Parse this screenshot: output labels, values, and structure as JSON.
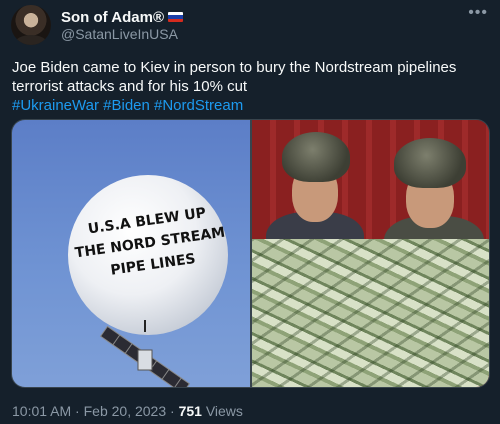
{
  "author": {
    "display_name": "Son of Adam®",
    "handle": "@SatanLiveInUSA"
  },
  "tweet": {
    "text": "Joe Biden came to Kiev in person to bury the Nordstream pipelines terrorist attacks and for his 10% cut",
    "hashtags": "#UkraineWar #Biden #NordStream"
  },
  "media": {
    "balloon_line1": "U.S.A BLEW UP",
    "balloon_line2": "THE NORD STREAM",
    "balloon_line3": "PIPE LINES"
  },
  "meta": {
    "time": "10:01 AM",
    "separator1": " · ",
    "date": "Feb 20, 2023",
    "separator2": " · ",
    "views_count": "751",
    "views_label": " Views"
  },
  "icons": {
    "more": "more-horizontal-icon",
    "flag": "russia-flag-icon"
  },
  "colors": {
    "background": "#15202b",
    "text_primary": "#f7f9f9",
    "text_secondary": "#8b98a5",
    "link": "#1d9bf0"
  }
}
